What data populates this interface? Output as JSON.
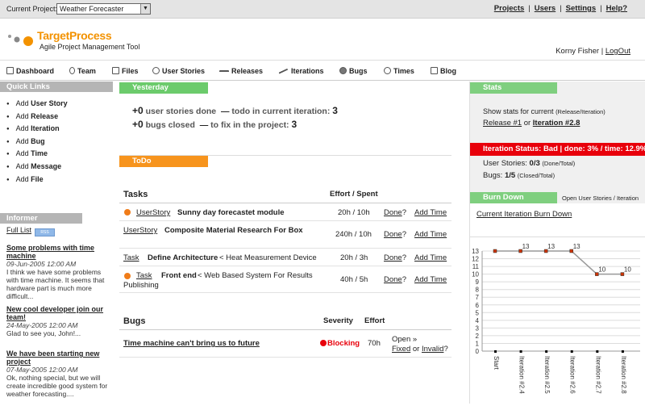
{
  "topbar": {
    "current_project_label": "Current Project:",
    "current_project_value": "Weather Forecaster",
    "links": [
      "Projects",
      "Users",
      "Settings",
      "Help?"
    ]
  },
  "header": {
    "logo_name": "TargetProcess",
    "logo_subtitle": "Agile Project Management Tool",
    "user_name": "Korny Fisher",
    "logout_label": "LogOut"
  },
  "nav": [
    "Dashboard",
    "Team",
    "Files",
    "User Stories",
    "Releases",
    "Iterations",
    "Bugs",
    "Times",
    "Blog"
  ],
  "quick_links": {
    "title": "Quick Links",
    "items": [
      {
        "prefix": "Add",
        "name": "User Story"
      },
      {
        "prefix": "Add",
        "name": "Release"
      },
      {
        "prefix": "Add",
        "name": "Iteration"
      },
      {
        "prefix": "Add",
        "name": "Bug"
      },
      {
        "prefix": "Add",
        "name": "Time"
      },
      {
        "prefix": "Add",
        "name": "Message"
      },
      {
        "prefix": "Add",
        "name": "File"
      }
    ]
  },
  "informer": {
    "title": "Informer",
    "full_list": "Full List",
    "rss": "RSS",
    "news": [
      {
        "title": "Some problems with time machine",
        "date": "09-Jun-2005 12:00 AM",
        "body": "I think we have some problems with time machine. It seems that hardware part is much more difficult..."
      },
      {
        "title": "New cool developer join our team!",
        "date": "24-May-2005 12:00 AM",
        "body": "Glad to see you, John!..."
      },
      {
        "title": "We have been starting new project",
        "date": "07-May-2005 12:00 AM",
        "body": "Ok, nothing special, but we will create incredible good system for weather forecasting...."
      }
    ]
  },
  "yesterday": {
    "title": "Yesterday",
    "stories_done": "+0",
    "stories_done_label": "user stories done",
    "todo_label": "todo in current iteration:",
    "todo_count": "3",
    "bugs_closed": "+0",
    "bugs_closed_label": "bugs closed",
    "fix_label": "to fix in the project:",
    "fix_count": "3",
    "dash": "—"
  },
  "todo": {
    "title": "ToDo",
    "tasks_header": "Tasks",
    "effort_header": "Effort / Spent",
    "tasks": [
      {
        "type": "UserStory",
        "name": "Sunny day forecastet module",
        "parent": "",
        "effort": "20h / 10h",
        "done": "Done",
        "q": "?",
        "add": "Add Time",
        "running": true
      },
      {
        "type": "UserStory",
        "name": "Composite Material Research For Box",
        "parent": "",
        "effort": "240h / 10h",
        "done": "Done",
        "q": "?",
        "add": "Add Time",
        "running": false
      },
      {
        "type": "Task",
        "name": "Define Architecture",
        "parent": "< Heat Measurement Device",
        "effort": "20h / 3h",
        "done": "Done",
        "q": "?",
        "add": "Add Time",
        "running": false
      },
      {
        "type": "Task",
        "name": "Front end",
        "parent": "< Web Based System For Results",
        "parent2": "Publishing",
        "effort": "40h / 5h",
        "done": "Done",
        "q": "?",
        "add": "Add Time",
        "running": true
      }
    ],
    "bugs_header": "Bugs",
    "severity_header": "Severity",
    "bug_effort_header": "Effort",
    "bugs": [
      {
        "name": "Time machine can't bring us to future",
        "severity": "Blocking",
        "effort": "70h",
        "state": "Open »",
        "fixed": "Fixed",
        "or": "or",
        "invalid": "Invalid",
        "q": "?"
      }
    ]
  },
  "stats": {
    "title": "Stats",
    "show_for": "Show stats for current",
    "show_for_paren": "(Release/Iteration)",
    "release": "Release #1",
    "or": "or",
    "iteration": "Iteration #2.8",
    "status": "Iteration Status: Bad | done: 3% / time: 12.9%",
    "user_stories_label": "User Stories:",
    "user_stories_value": "0/3",
    "user_stories_suffix": "(Done/Total)",
    "bugs_label": "Bugs:",
    "bugs_value": "1/5",
    "bugs_suffix": "(Closed/Total)",
    "burn_title": "Burn Down",
    "burn_subtitle": "Open User Stories / Iteration",
    "burn_link": "Current Iteration Burn Down"
  },
  "chart_data": {
    "type": "line",
    "categories": [
      "Start",
      "Iteration #2.4",
      "Iteration #2.5",
      "Iteration #2.6",
      "Iteration #2.7",
      "Iteration #2.8"
    ],
    "values": [
      13,
      13,
      13,
      13,
      10,
      10
    ],
    "point_labels": [
      "",
      "13",
      "13",
      "13",
      "10",
      "10"
    ],
    "ylim": [
      0,
      13
    ],
    "yticks": [
      0,
      1,
      2,
      3,
      4,
      5,
      6,
      7,
      8,
      9,
      10,
      11,
      12,
      13
    ],
    "grid": true,
    "line_color": "#999999",
    "marker_color": "#cc3300"
  }
}
